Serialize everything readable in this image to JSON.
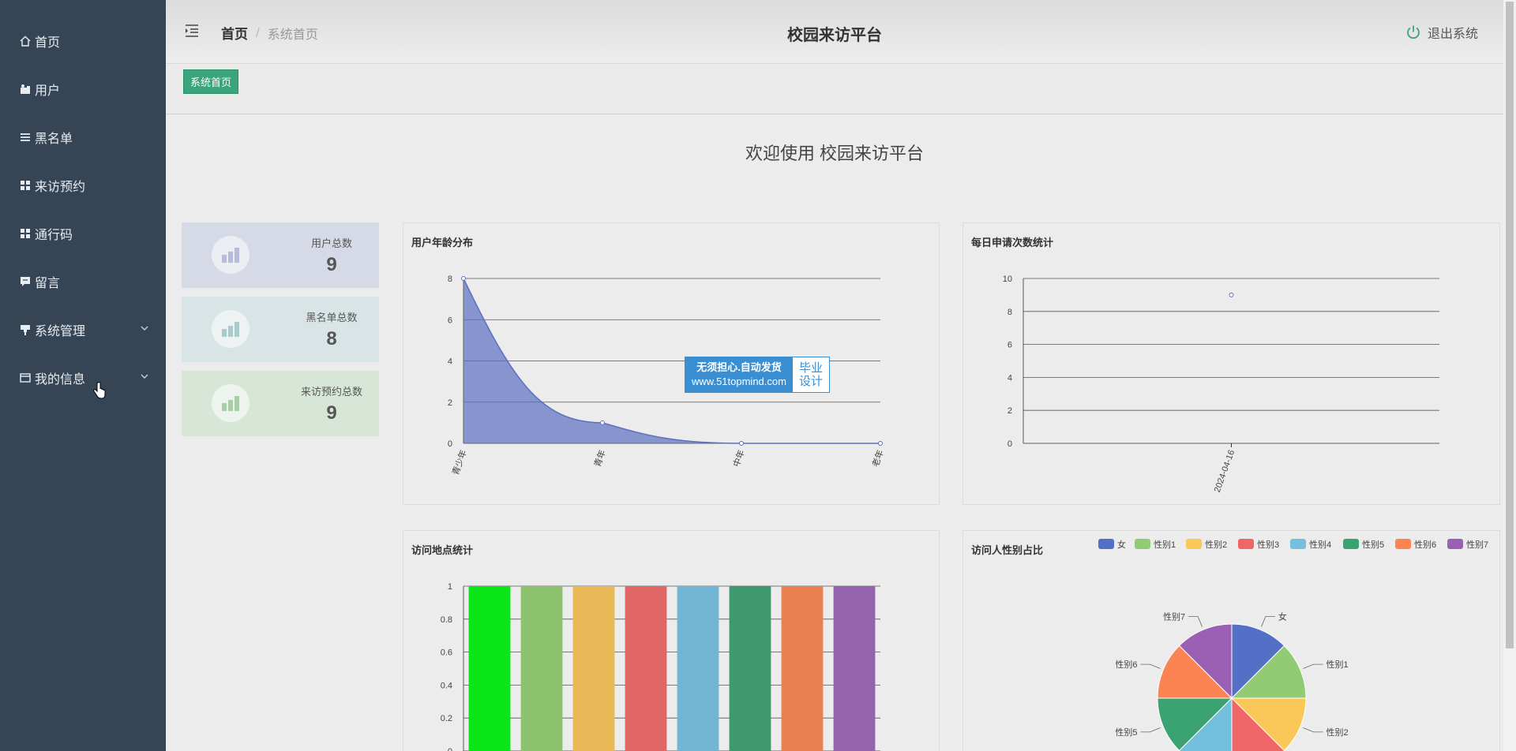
{
  "sidebar": {
    "items": [
      {
        "label": "首页",
        "icon": "home-icon"
      },
      {
        "label": "用户",
        "icon": "user-icon"
      },
      {
        "label": "黑名单",
        "icon": "list-icon"
      },
      {
        "label": "来访预约",
        "icon": "grid-icon"
      },
      {
        "label": "通行码",
        "icon": "grid-icon"
      },
      {
        "label": "留言",
        "icon": "message-icon"
      },
      {
        "label": "系统管理",
        "icon": "pin-icon",
        "expandable": true
      },
      {
        "label": "我的信息",
        "icon": "card-icon",
        "expandable": true
      }
    ]
  },
  "header": {
    "breadcrumb_home": "首页",
    "breadcrumb_separator": "/",
    "breadcrumb_current": "系统首页",
    "title": "校园来访平台",
    "logout_label": "退出系统"
  },
  "tagbar": {
    "tag_label": "系统首页"
  },
  "welcome": "欢迎使用 校园来访平台",
  "stats": [
    {
      "label": "用户总数",
      "value": "9",
      "color": "#d6d9e6"
    },
    {
      "label": "黑名单总数",
      "value": "8",
      "color": "#d8e4e5"
    },
    {
      "label": "来访预约总数",
      "value": "9",
      "color": "#d8e6d8"
    }
  ],
  "watermark": {
    "line1": "无须担心.自动发货",
    "line2": "www.51topmind.com",
    "right1": "毕业",
    "right2": "设计"
  },
  "chart_data": [
    {
      "type": "area",
      "title": "用户年龄分布",
      "categories": [
        "青少年",
        "青年",
        "中年",
        "老年"
      ],
      "values": [
        8,
        1,
        0,
        0
      ],
      "ylim": [
        0,
        8
      ],
      "yticks": [
        0,
        2,
        4,
        6,
        8
      ],
      "color": "#5b70c1"
    },
    {
      "type": "scatter",
      "title": "每日申请次数统计",
      "categories": [
        "2024-04-16"
      ],
      "values": [
        9
      ],
      "ylim": [
        0,
        10
      ],
      "yticks": [
        0,
        2,
        4,
        6,
        8,
        10
      ],
      "color": "#5b70c1"
    },
    {
      "type": "bar",
      "title": "访问地点统计",
      "values": [
        1,
        1,
        1,
        1,
        1,
        1,
        1,
        1
      ],
      "colors": [
        "#0be618",
        "#8dc26f",
        "#e8b956",
        "#e06666",
        "#72b4d3",
        "#3e9a6e",
        "#ea8150",
        "#9563ae"
      ],
      "ylim": [
        0,
        1
      ],
      "yticks": [
        "0",
        "0.2",
        "0.4",
        "0.6",
        "0.8",
        "1"
      ]
    },
    {
      "type": "pie",
      "title": "访问人性别占比",
      "categories": [
        "女",
        "性别1",
        "性别2",
        "性别3",
        "性别4",
        "性别5",
        "性别6",
        "性别7"
      ],
      "values": [
        1,
        1,
        1,
        1,
        1,
        1,
        1,
        1
      ],
      "colors": [
        "#5470c6",
        "#91cc75",
        "#fac858",
        "#ee6666",
        "#73c0de",
        "#3ba272",
        "#fc8452",
        "#9a60b4"
      ],
      "legend": "top-right"
    }
  ]
}
